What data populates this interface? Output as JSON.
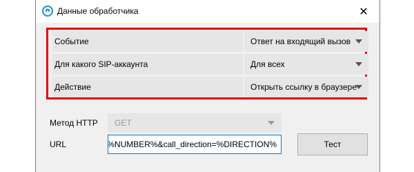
{
  "window": {
    "title": "Данные обработчика"
  },
  "settings": {
    "rows": [
      {
        "label": "Событие",
        "value": "Ответ на входящий вызов"
      },
      {
        "label": "Для какого SIP-аккаунта",
        "value": "Для всех"
      },
      {
        "label": "Действие",
        "value": "Открыть ссылку в браузере"
      }
    ]
  },
  "http": {
    "label": "Метод HTTP",
    "value": "GET"
  },
  "url": {
    "label": "URL",
    "value": "er=%NUMBER%&call_direction=%DIRECTION%"
  },
  "test_button": "Тест",
  "colors": {
    "highlight": "#e3000f",
    "focus": "#0078d7",
    "icon": "#1a8fd8"
  }
}
